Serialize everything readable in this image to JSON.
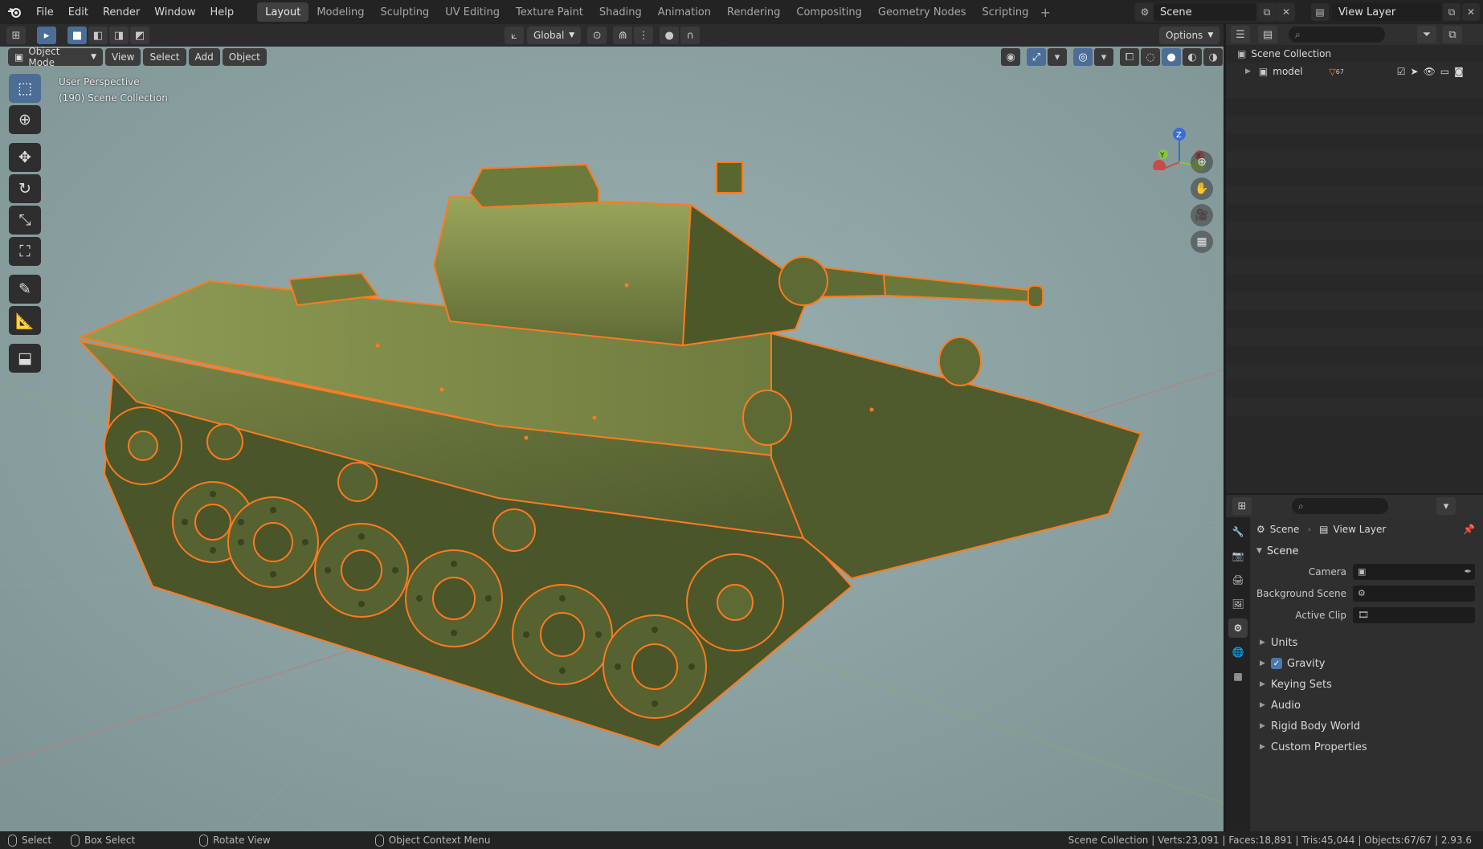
{
  "topbar": {
    "logo_icon": "blender-logo-icon",
    "menu": [
      "File",
      "Edit",
      "Render",
      "Window",
      "Help"
    ],
    "workspaces": [
      "Layout",
      "Modeling",
      "Sculpting",
      "UV Editing",
      "Texture Paint",
      "Shading",
      "Animation",
      "Rendering",
      "Compositing",
      "Geometry Nodes",
      "Scripting"
    ],
    "active_workspace": "Layout",
    "scene": "Scene",
    "view_layer": "View Layer"
  },
  "viewport": {
    "transform_orientation": "Global",
    "options_label": "Options",
    "mode": "Object Mode",
    "header_menus": [
      "View",
      "Select",
      "Add",
      "Object"
    ],
    "perspective_label": "User Perspective",
    "collection_label": "(190) Scene Collection",
    "background_color": "#8fa5a5",
    "selection_outline_color": "#ff7a1f",
    "model_color": "#5e6a34",
    "gizmo_axes": {
      "x": "X",
      "y": "Y",
      "z": "Z"
    }
  },
  "outliner": {
    "search_placeholder": "",
    "root": "Scene Collection",
    "items": [
      {
        "name": "model",
        "badge": "67"
      }
    ]
  },
  "properties": {
    "context_scene": "Scene",
    "context_view_layer": "View Layer",
    "section": "Scene",
    "fields": [
      {
        "label": "Camera",
        "value": ""
      },
      {
        "label": "Background Scene",
        "value": ""
      },
      {
        "label": "Active Clip",
        "value": ""
      }
    ],
    "subsections": [
      {
        "label": "Units",
        "checkbox": false
      },
      {
        "label": "Gravity",
        "checkbox": true
      },
      {
        "label": "Keying Sets",
        "checkbox": false
      },
      {
        "label": "Audio",
        "checkbox": false
      },
      {
        "label": "Rigid Body World",
        "checkbox": false
      },
      {
        "label": "Custom Properties",
        "checkbox": false
      }
    ]
  },
  "statusbar": {
    "select": "Select",
    "box_select": "Box Select",
    "rotate_view": "Rotate View",
    "context_menu": "Object Context Menu",
    "stats": "Scene Collection | Verts:23,091 | Faces:18,891 | Tris:45,044 | Objects:67/67 | 2.93.6"
  }
}
